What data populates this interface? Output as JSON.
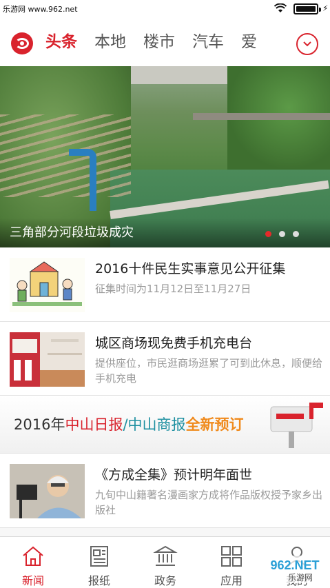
{
  "status_bar": {
    "watermark": "乐游网 www.962.net",
    "charging_icon": "⚡"
  },
  "channel_bar": {
    "logo_icon": "app-logo-icon",
    "tabs": [
      "头条",
      "本地",
      "楼市",
      "汽车",
      "爱"
    ],
    "active_tab": "头条",
    "more_icon": "chevron-down-icon"
  },
  "hero": {
    "caption": "三角部分河段垃圾成灾",
    "slides": 3,
    "active_slide": 1
  },
  "news": [
    {
      "title": "2016十件民生实事意见公开征集",
      "desc": "征集时间为11月12日至11月27日"
    },
    {
      "title": "城区商场现免费手机充电台",
      "desc": "提供座位，市民逛商场逛累了可到此休息，顺便给手机充电"
    },
    {
      "title": "《方成全集》预计明年面世",
      "desc": "九旬中山籍著名漫画家方成将作品版权授予家乡出版社"
    }
  ],
  "ad": {
    "prefix": "2016年",
    "paper1": "中山日报",
    "sep": "/",
    "paper2": "中山商报",
    "suffix": "全新预订"
  },
  "bottom_nav": [
    {
      "label": "新闻",
      "icon": "home-icon",
      "active": true
    },
    {
      "label": "报纸",
      "icon": "newspaper-icon",
      "active": false
    },
    {
      "label": "政务",
      "icon": "government-building-icon",
      "active": false
    },
    {
      "label": "应用",
      "icon": "apps-grid-icon",
      "active": false
    },
    {
      "label": "我的",
      "icon": "user-icon",
      "active": false
    }
  ],
  "colors": {
    "accent": "#d9232d",
    "muted_text": "#9a9a9a"
  },
  "watermark_logo": {
    "text": "962.NET",
    "subtext": "乐游网"
  }
}
